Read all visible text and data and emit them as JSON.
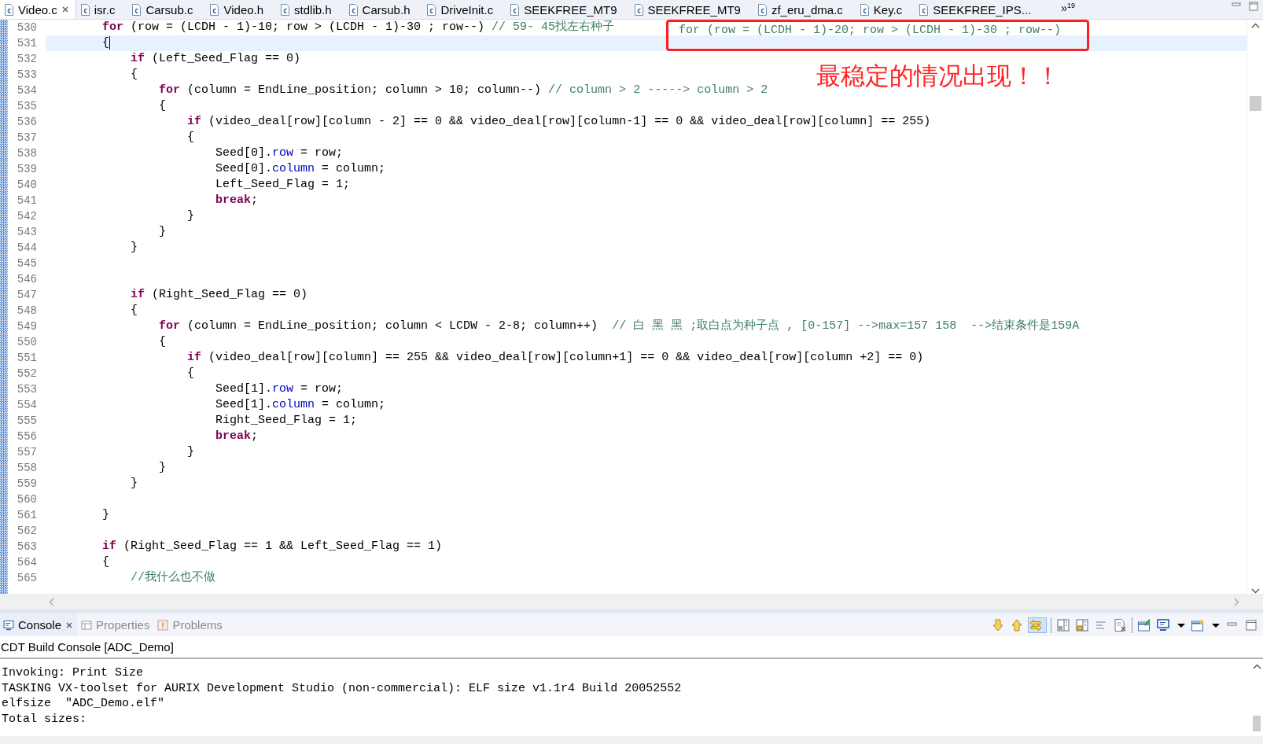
{
  "editor_tabs": [
    {
      "label": "Video.c",
      "selected": true,
      "closable": true
    },
    {
      "label": "isr.c",
      "selected": false,
      "closable": false
    },
    {
      "label": "Carsub.c",
      "selected": false,
      "closable": false
    },
    {
      "label": "Video.h",
      "selected": false,
      "closable": false
    },
    {
      "label": "stdlib.h",
      "selected": false,
      "closable": false
    },
    {
      "label": "Carsub.h",
      "selected": false,
      "closable": false
    },
    {
      "label": "DriveInit.c",
      "selected": false,
      "closable": false
    },
    {
      "label": "SEEKFREE_MT9",
      "selected": false,
      "closable": false
    },
    {
      "label": "SEEKFREE_MT9",
      "selected": false,
      "closable": false
    },
    {
      "label": "zf_eru_dma.c",
      "selected": false,
      "closable": false
    },
    {
      "label": "Key.c",
      "selected": false,
      "closable": false
    },
    {
      "label": "SEEKFREE_IPS...",
      "selected": false,
      "closable": false
    }
  ],
  "tab_overflow": {
    "marker": "»",
    "count": "19"
  },
  "code_lines": [
    {
      "number": "530",
      "current": false,
      "segments": [
        {
          "kind": "keyword",
          "text": "        for"
        },
        {
          "kind": "text",
          "text": " (row = (LCDH - 1)-10; row > (LCDH - 1)-30 ; row--) "
        },
        {
          "kind": "comment",
          "text": "// 59- 45找左右种子"
        }
      ]
    },
    {
      "number": "531",
      "current": true,
      "segments": [
        {
          "kind": "text",
          "text": "        {"
        }
      ]
    },
    {
      "number": "532",
      "current": false,
      "segments": [
        {
          "kind": "keyword",
          "text": "            if"
        },
        {
          "kind": "text",
          "text": " (Left_Seed_Flag == 0)"
        }
      ]
    },
    {
      "number": "533",
      "current": false,
      "segments": [
        {
          "kind": "text",
          "text": "            {"
        }
      ]
    },
    {
      "number": "534",
      "current": false,
      "segments": [
        {
          "kind": "keyword",
          "text": "                for"
        },
        {
          "kind": "text",
          "text": " (column = EndLine_position; column > 10; column--) "
        },
        {
          "kind": "comment",
          "text": "// column > 2 -----> column > 2"
        }
      ]
    },
    {
      "number": "535",
      "current": false,
      "segments": [
        {
          "kind": "text",
          "text": "                {"
        }
      ]
    },
    {
      "number": "536",
      "current": false,
      "segments": [
        {
          "kind": "keyword",
          "text": "                    if"
        },
        {
          "kind": "text",
          "text": " (video_deal[row][column - 2] == 0 && video_deal[row][column-1] == 0 && video_deal[row][column] == 255)"
        }
      ]
    },
    {
      "number": "537",
      "current": false,
      "segments": [
        {
          "kind": "text",
          "text": "                    {"
        }
      ]
    },
    {
      "number": "538",
      "current": false,
      "segments": [
        {
          "kind": "text",
          "text": "                        Seed[0]."
        },
        {
          "kind": "field",
          "text": "row"
        },
        {
          "kind": "text",
          "text": " = row;"
        }
      ]
    },
    {
      "number": "539",
      "current": false,
      "segments": [
        {
          "kind": "text",
          "text": "                        Seed[0]."
        },
        {
          "kind": "field",
          "text": "column"
        },
        {
          "kind": "text",
          "text": " = column;"
        }
      ]
    },
    {
      "number": "540",
      "current": false,
      "segments": [
        {
          "kind": "text",
          "text": "                        Left_Seed_Flag = 1;"
        }
      ]
    },
    {
      "number": "541",
      "current": false,
      "segments": [
        {
          "kind": "keyword",
          "text": "                        break"
        },
        {
          "kind": "text",
          "text": ";"
        }
      ]
    },
    {
      "number": "542",
      "current": false,
      "segments": [
        {
          "kind": "text",
          "text": "                    }"
        }
      ]
    },
    {
      "number": "543",
      "current": false,
      "segments": [
        {
          "kind": "text",
          "text": "                }"
        }
      ]
    },
    {
      "number": "544",
      "current": false,
      "segments": [
        {
          "kind": "text",
          "text": "            }"
        }
      ]
    },
    {
      "number": "545",
      "current": false
    },
    {
      "number": "546",
      "current": false
    },
    {
      "number": "547",
      "current": false,
      "segments": [
        {
          "kind": "keyword",
          "text": "            if"
        },
        {
          "kind": "text",
          "text": " (Right_Seed_Flag == 0)"
        }
      ]
    },
    {
      "number": "548",
      "current": false,
      "segments": [
        {
          "kind": "text",
          "text": "            {"
        }
      ]
    },
    {
      "number": "549",
      "current": false,
      "segments": [
        {
          "kind": "keyword",
          "text": "                for"
        },
        {
          "kind": "text",
          "text": " (column = EndLine_position; column < LCDW - 2-8; column++)  "
        },
        {
          "kind": "comment",
          "text": "// 白 黑 黑 ;取白点为种子点 , [0-157] -->max=157 158  -->结束条件是159A"
        }
      ]
    },
    {
      "number": "550",
      "current": false,
      "segments": [
        {
          "kind": "text",
          "text": "                {"
        }
      ]
    },
    {
      "number": "551",
      "current": false,
      "segments": [
        {
          "kind": "keyword",
          "text": "                    if"
        },
        {
          "kind": "text",
          "text": " (video_deal[row][column] == 255 && video_deal[row][column+1] == 0 && video_deal[row][column +2] == 0)"
        }
      ]
    },
    {
      "number": "552",
      "current": false,
      "segments": [
        {
          "kind": "text",
          "text": "                    {"
        }
      ]
    },
    {
      "number": "553",
      "current": false,
      "segments": [
        {
          "kind": "text",
          "text": "                        Seed[1]."
        },
        {
          "kind": "field",
          "text": "row"
        },
        {
          "kind": "text",
          "text": " = row;"
        }
      ]
    },
    {
      "number": "554",
      "current": false,
      "segments": [
        {
          "kind": "text",
          "text": "                        Seed[1]."
        },
        {
          "kind": "field",
          "text": "column"
        },
        {
          "kind": "text",
          "text": " = column;"
        }
      ]
    },
    {
      "number": "555",
      "current": false,
      "segments": [
        {
          "kind": "text",
          "text": "                        Right_Seed_Flag = 1;"
        }
      ]
    },
    {
      "number": "556",
      "current": false,
      "segments": [
        {
          "kind": "keyword",
          "text": "                        break"
        },
        {
          "kind": "text",
          "text": ";"
        }
      ]
    },
    {
      "number": "557",
      "current": false,
      "segments": [
        {
          "kind": "text",
          "text": "                    }"
        }
      ]
    },
    {
      "number": "558",
      "current": false,
      "segments": [
        {
          "kind": "text",
          "text": "                }"
        }
      ]
    },
    {
      "number": "559",
      "current": false,
      "segments": [
        {
          "kind": "text",
          "text": "            }"
        }
      ]
    },
    {
      "number": "560",
      "current": false
    },
    {
      "number": "561",
      "current": false,
      "segments": [
        {
          "kind": "text",
          "text": "        }"
        }
      ]
    },
    {
      "number": "562",
      "current": false
    },
    {
      "number": "563",
      "current": false,
      "segments": [
        {
          "kind": "keyword",
          "text": "        if"
        },
        {
          "kind": "text",
          "text": " (Right_Seed_Flag == 1 && Left_Seed_Flag == 1)"
        }
      ]
    },
    {
      "number": "564",
      "current": false,
      "segments": [
        {
          "kind": "text",
          "text": "        {"
        }
      ]
    },
    {
      "number": "565",
      "current": false,
      "segments": [
        {
          "kind": "comment",
          "text": "            //我什么也不做"
        }
      ]
    }
  ],
  "annotation": {
    "code": "for (row = (LCDH - 1)-20; row > (LCDH - 1)-30 ; row--)",
    "note": "最稳定的情况出现！！"
  },
  "console": {
    "tabs": [
      {
        "label": "Console",
        "selected": true,
        "closable": true
      },
      {
        "label": "Properties",
        "selected": false,
        "closable": false
      },
      {
        "label": "Problems",
        "selected": false,
        "closable": false
      }
    ],
    "title": "CDT Build Console [ADC_Demo]",
    "lines": [
      "Invoking: Print Size",
      "TASKING VX-toolset for AURIX Development Studio (non-commercial): ELF size v1.1r4 Build 20052552",
      "elfsize  \"ADC_Demo.elf\"",
      "Total sizes:"
    ]
  }
}
